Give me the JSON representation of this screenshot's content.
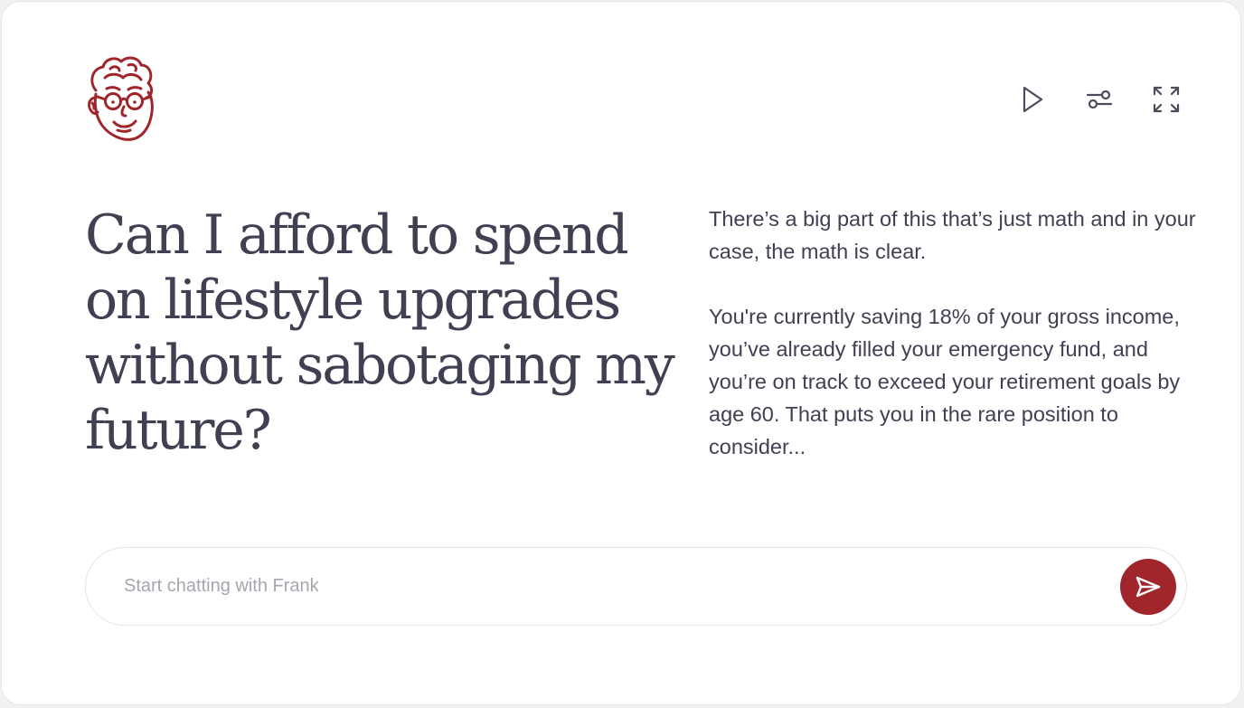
{
  "brand": {
    "avatar_icon": "frank-avatar-icon",
    "accent_color": "#a0262c"
  },
  "toolbar": {
    "play_icon": "play-icon",
    "settings_icon": "sliders-icon",
    "fullscreen_icon": "expand-icon"
  },
  "question": {
    "text": "Can I afford to spend on lifestyle upgrades without sabotaging my future?"
  },
  "answer": {
    "paragraph_1": "There’s a big part of this that’s just math and in your case, the math is clear.",
    "paragraph_2": "You're currently saving 18% of your gross income, you’ve already filled your emergency fund, and you’re on track to exceed your retirement goals by age 60. That puts you in the rare position to consider..."
  },
  "chat": {
    "placeholder": "Start chatting with Frank",
    "value": "",
    "send_icon": "send-icon"
  }
}
